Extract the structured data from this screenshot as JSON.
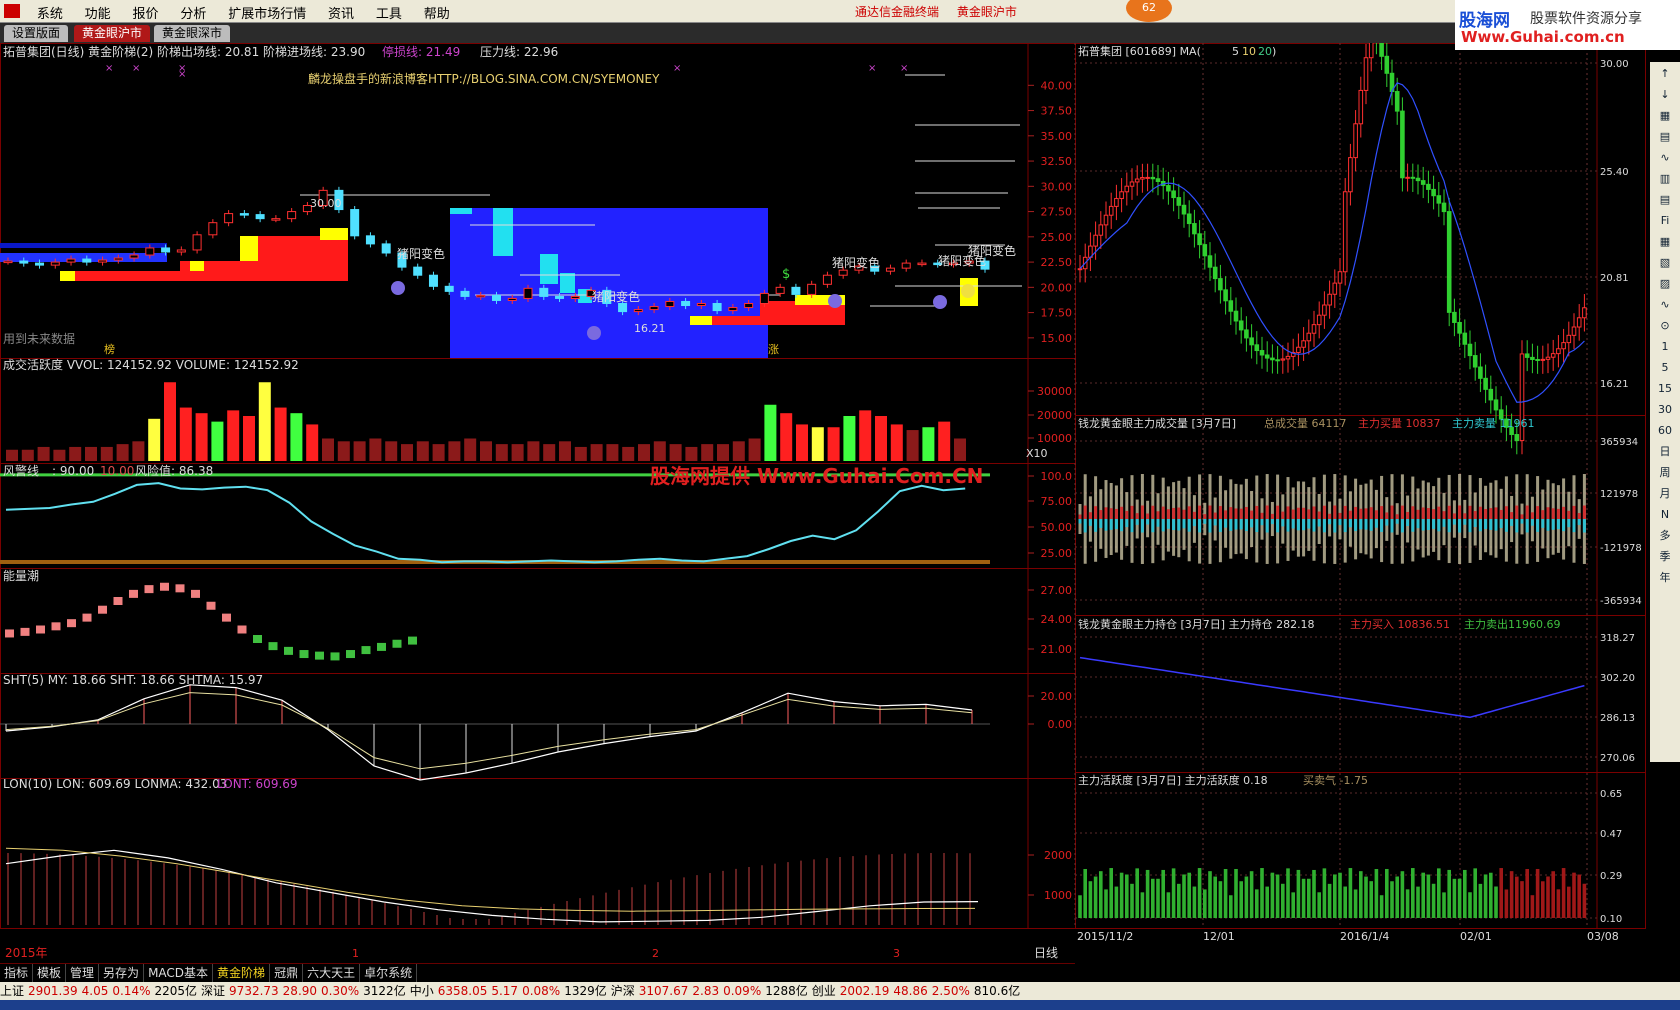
{
  "menu": [
    "系统",
    "功能",
    "报价",
    "分析",
    "扩展市场行情",
    "资讯",
    "工具",
    "帮助"
  ],
  "center_links": [
    "通达信金融终端",
    "黄金眼沪市"
  ],
  "badge": "62",
  "brand": {
    "name": "股海网",
    "slogan": "股票软件资源分享",
    "url": "Www.Guhai.com.cn"
  },
  "tabs": [
    {
      "label": "设置版面",
      "active": false
    },
    {
      "label": "黄金眼沪市",
      "active": true
    },
    {
      "label": "黄金眼深市",
      "active": false
    }
  ],
  "main_panel": {
    "title": "拓普集团(日线) 黄金阶梯(2) 阶梯出场线: 20.81  阶梯进场线: 23.90",
    "title2_a": "停损线: 21.49",
    "title2_b": "压力线: 22.96",
    "blog": "麟龙操盘手的新浪博客HTTP://BLOG.SINA.COM.CN/SYEMONEY",
    "high_label": "30.00",
    "low_label": "16.21",
    "signals": [
      "猪阳变色",
      "猪阳变色",
      "猪阳变色",
      "猪阳变色",
      "猪阳变色"
    ],
    "future_note": "用到未来数据",
    "tag1": "榜",
    "tag2": "涨",
    "y_ticks": [
      "40.00",
      "37.50",
      "35.00",
      "32.50",
      "30.00",
      "27.50",
      "25.00",
      "22.50",
      "20.00",
      "17.50",
      "15.00"
    ]
  },
  "vol_panel": {
    "title": "成交活跃度 VVOL: 124152.92  VOLUME: 124152.92",
    "y_ticks": [
      "30000",
      "20000",
      "10000"
    ],
    "unit": "X10"
  },
  "risk_panel": {
    "title_a": "风警线",
    "v1": ": 90.00",
    "v2": "10.00",
    "title_b": "风险值: 86.38",
    "watermark": "股海网提供 Www.Guhai.Com.CN",
    "y_ticks": [
      "100.0",
      "75.00",
      "50.00",
      "25.00"
    ]
  },
  "energy_panel": {
    "title": "能量潮",
    "y_ticks": [
      "27.00",
      "24.00",
      "21.00"
    ]
  },
  "sht_panel": {
    "title": "SHT(5)  MY: 18.66  SHT: 18.66  SHTMA: 15.97",
    "y_ticks": [
      "20.00",
      "0.00"
    ]
  },
  "lon_panel": {
    "title_a": "LON(10)  LON: 609.69  LONMA: 432.03",
    "title_b": "LONT: 609.69",
    "y_ticks": [
      "2000",
      "1000"
    ]
  },
  "time_axis": {
    "year": "2015年",
    "marks": [
      "1",
      "2",
      "3"
    ],
    "period": "日线"
  },
  "right": {
    "p1_title": "拓普集团 [601689] MA(",
    "ma_a": "5",
    "ma_b": "10",
    "ma_c": "20",
    "p1_close": ")",
    "p1_ticks": [
      "30.00",
      "25.40",
      "20.81",
      "16.21"
    ],
    "p2_title": "钱龙黄金眼主力成交量 [3月7日]",
    "p2_total": "总成交量 64117",
    "p2_buy": "主力买量 10837",
    "p2_sell": "主力卖量 11961",
    "p2_ticks": [
      "365934",
      "121978",
      "-121978",
      "-365934"
    ],
    "p3_title": "钱龙黄金眼主力持仓 [3月7日]  主力持仓 282.18",
    "p3_in": "主力买入 10836.51",
    "p3_out": "主力卖出11960.69",
    "p3_ticks": [
      "318.27",
      "302.20",
      "286.13",
      "270.06"
    ],
    "p4_title": "主力活跃度 [3月7日]  主力活跃度 0.18",
    "p4_gas": "买卖气 -1.75",
    "p4_ticks": [
      "0.65",
      "0.47",
      "0.29",
      "0.10"
    ],
    "dates": [
      "2015/11/2",
      "12/01",
      "2016/1/4",
      "02/01",
      "03/08"
    ]
  },
  "side_tools": [
    "1",
    "5",
    "15",
    "30",
    "60",
    "日",
    "周",
    "月",
    "N",
    "多",
    "季",
    "年"
  ],
  "bottom_tabs": [
    "指标",
    "模板",
    "管理",
    "另存为",
    "MACD基本",
    "黄金阶梯",
    "冠鼎",
    "六大天王",
    "卓尔系统"
  ],
  "status": [
    {
      "t": "上证",
      "c": "#000"
    },
    {
      "t": "2901.39",
      "c": "#c00"
    },
    {
      "t": "4.05",
      "c": "#c00"
    },
    {
      "t": "0.14%",
      "c": "#c00"
    },
    {
      "t": "2205亿",
      "c": "#000"
    },
    {
      "t": "深证",
      "c": "#000"
    },
    {
      "t": "9732.73",
      "c": "#c00"
    },
    {
      "t": "28.90",
      "c": "#c00"
    },
    {
      "t": "0.30%",
      "c": "#c00"
    },
    {
      "t": "3122亿",
      "c": "#000"
    },
    {
      "t": "中小",
      "c": "#000"
    },
    {
      "t": "6358.05",
      "c": "#c00"
    },
    {
      "t": "5.17",
      "c": "#c00"
    },
    {
      "t": "0.08%",
      "c": "#c00"
    },
    {
      "t": "1329亿",
      "c": "#000"
    },
    {
      "t": "沪深",
      "c": "#000"
    },
    {
      "t": "3107.67",
      "c": "#c00"
    },
    {
      "t": "2.83",
      "c": "#c00"
    },
    {
      "t": "0.09%",
      "c": "#c00"
    },
    {
      "t": "1288亿",
      "c": "#000"
    },
    {
      "t": "创业",
      "c": "#000"
    },
    {
      "t": "2002.19",
      "c": "#c00"
    },
    {
      "t": "48.86",
      "c": "#c00"
    },
    {
      "t": "2.50%",
      "c": "#c00"
    },
    {
      "t": "810.6亿",
      "c": "#000"
    }
  ],
  "chart_data": {
    "type": "candlestick",
    "stock": "拓普集团",
    "code": "601689",
    "left_price_range": [
      13.5,
      43
    ],
    "left_close": [
      22.6,
      22.4,
      22.2,
      22.5,
      22.8,
      22.5,
      22.7,
      22.9,
      23.2,
      23.9,
      23.5,
      23.7,
      25.2,
      26.4,
      27.3,
      27.2,
      26.8,
      26.8,
      27.5,
      28.1,
      29.6,
      27.7,
      25.1,
      24.3,
      23.4,
      22.0,
      21.2,
      20.1,
      19.6,
      19.1,
      19.2,
      18.7,
      18.9,
      19.9,
      19.1,
      18.9,
      19.1,
      19.7,
      18.4,
      17.6,
      17.8,
      18.1,
      18.6,
      18.2,
      18.4,
      17.7,
      18.0,
      18.4,
      19.4,
      20.0,
      19.3,
      20.3,
      21.2,
      21.7,
      22.1,
      21.6,
      21.9,
      22.4,
      22.4,
      22.3,
      22.4,
      22.6,
      21.8
    ],
    "left_dates": [
      "2015-12",
      "2016-01",
      "2016-02",
      "2016-03"
    ],
    "vol_series": [
      4,
      4,
      5,
      4,
      5,
      5,
      5,
      6,
      7,
      15,
      28,
      19,
      17,
      14,
      18,
      16,
      28,
      19,
      17,
      13,
      8,
      7,
      7,
      8,
      7,
      6,
      7,
      6,
      7,
      8,
      7,
      6,
      6,
      7,
      6,
      7,
      5,
      6,
      6,
      5,
      6,
      7,
      6,
      5,
      6,
      6,
      7,
      8,
      20,
      17,
      13,
      12,
      12,
      16,
      18,
      16,
      13,
      11,
      12,
      14,
      8
    ],
    "risk_value": [
      62,
      63,
      64,
      68,
      71,
      80,
      90,
      92,
      86,
      85,
      87,
      88,
      84,
      70,
      49,
      35,
      22,
      15,
      7,
      6,
      3,
      4,
      4,
      3,
      4,
      5,
      4,
      3,
      4,
      6,
      7,
      5,
      4,
      7,
      10,
      18,
      27,
      33,
      29,
      39,
      60,
      83,
      89,
      84,
      86
    ],
    "energy": [
      21.5,
      21.7,
      22.0,
      22.4,
      22.8,
      23.5,
      24.5,
      25.6,
      26.5,
      27.1,
      27.4,
      27.2,
      26.5,
      25.0,
      23.5,
      22.0,
      20.8,
      19.9,
      19.3,
      18.9,
      18.7,
      18.6,
      18.9,
      19.4,
      19.8,
      20.2,
      20.6
    ],
    "sht_my": [
      -5,
      -2,
      3,
      18,
      28,
      26,
      17,
      -4,
      -30,
      -40,
      -35,
      -28,
      -20,
      -14,
      -9,
      -5,
      8,
      22,
      16,
      13,
      14,
      10
    ],
    "lon": [
      1600,
      1800,
      1950,
      1750,
      1450,
      1100,
      850,
      600,
      400,
      250,
      150,
      80,
      100,
      120,
      200,
      350,
      500,
      600,
      609.69
    ],
    "lonma": [
      2000,
      1950,
      1800,
      1600,
      1350,
      1100,
      850,
      650,
      500,
      420,
      380,
      360,
      370,
      390,
      410,
      420,
      430,
      432.03
    ]
  }
}
